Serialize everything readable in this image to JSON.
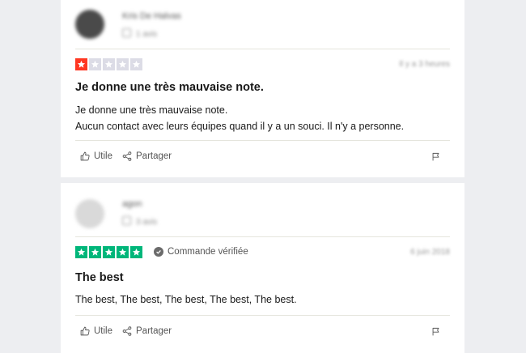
{
  "reviews": [
    {
      "user_name": "Kris De Halvas",
      "user_meta": "1 avis",
      "rating": 1,
      "rating_color": "#ff3722",
      "verified": false,
      "date": "Il y a 3 heures",
      "title": "Je donne une très mauvaise note.",
      "body_lines": [
        "Je donne une très mauvaise note.",
        "Aucun contact avec leurs équipes quand il y a un souci. Il n'y a personne."
      ],
      "useful_label": "Utile",
      "share_label": "Partager"
    },
    {
      "user_name": "agon",
      "user_meta": "3 avis",
      "rating": 5,
      "rating_color": "#00b67a",
      "verified": true,
      "verified_label": "Commande vérifiée",
      "date": "6 juin 2018",
      "title": "The best",
      "body_lines": [
        "The best, The best, The best, The best, The best."
      ],
      "useful_label": "Utile",
      "share_label": "Partager"
    }
  ],
  "colors": {
    "empty_star": "#dcdce6",
    "page_bg": "#edeef1"
  }
}
